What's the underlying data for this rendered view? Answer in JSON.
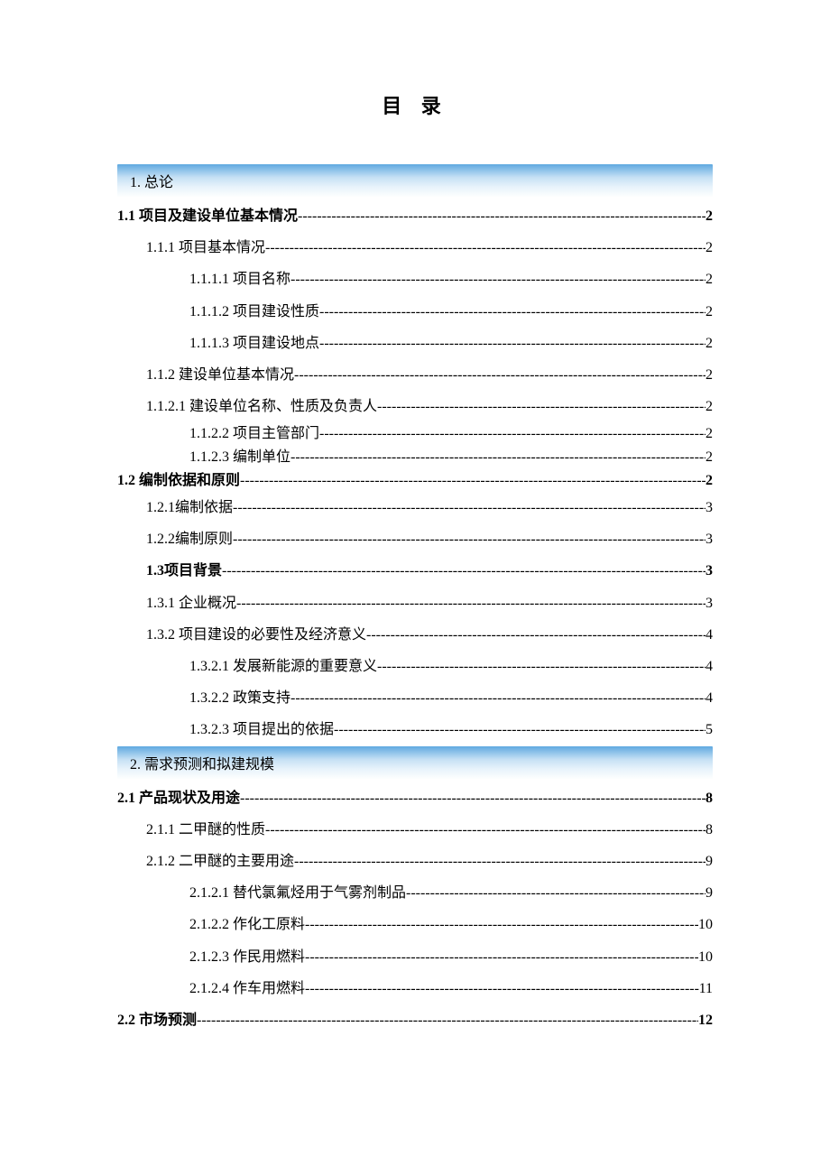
{
  "title": "目 录",
  "sections": [
    {
      "header": "1.  总论",
      "items": [
        {
          "label": "1.1 项目及建设单位基本情况",
          "page": "2",
          "indent": 0,
          "bold": true
        },
        {
          "label": "1.1.1 项目基本情况",
          "page": "2",
          "indent": 1,
          "bold": false
        },
        {
          "label": "1.1.1.1 项目名称",
          "page": "2",
          "indent": 2,
          "bold": false
        },
        {
          "label": "1.1.1.2 项目建设性质",
          "page": "2",
          "indent": 2,
          "bold": false
        },
        {
          "label": "1.1.1.3 项目建设地点",
          "page": "2",
          "indent": 2,
          "bold": false
        },
        {
          "label": "1.1.2 建设单位基本情况",
          "page": "2",
          "indent": 1,
          "bold": false
        },
        {
          "label": "1.1.2.1 建设单位名称、性质及负责人",
          "page": "2",
          "indent": 1,
          "bold": false
        },
        {
          "label": "1.1.2.2 项目主管部门",
          "page": "2",
          "indent": 2,
          "bold": false,
          "tight": true
        },
        {
          "label": "1.1.2.3 编制单位",
          "page": "2",
          "indent": 2,
          "bold": false,
          "tight": true
        },
        {
          "label": "1.2 编制依据和原则",
          "page": "2",
          "indent": 0,
          "bold": true,
          "tight": true
        },
        {
          "label": "1.2.1编制依据",
          "page": "3",
          "indent": 1,
          "bold": false
        },
        {
          "label": "1.2.2编制原则",
          "page": "3",
          "indent": 1,
          "bold": false
        },
        {
          "label": "1.3项目背景",
          "page": "3",
          "indent": 1,
          "bold": true
        },
        {
          "label": "1.3.1 企业概况",
          "page": "3",
          "indent": 1,
          "bold": false
        },
        {
          "label": "1.3.2 项目建设的必要性及经济意义",
          "page": "4",
          "indent": 1,
          "bold": false
        },
        {
          "label": "1.3.2.1 发展新能源的重要意义",
          "page": "4",
          "indent": 2,
          "bold": false
        },
        {
          "label": "1.3.2.2 政策支持",
          "page": "4",
          "indent": 2,
          "bold": false
        },
        {
          "label": "1.3.2.3 项目提出的依据",
          "page": "5",
          "indent": 2,
          "bold": false
        }
      ]
    },
    {
      "header": "2.  需求预测和拟建规模",
      "items": [
        {
          "label": "2.1 产品现状及用途",
          "page": "8",
          "indent": 0,
          "bold": true
        },
        {
          "label": "2.1.1 二甲醚的性质",
          "page": "8",
          "indent": 1,
          "bold": false
        },
        {
          "label": "2.1.2 二甲醚的主要用途",
          "page": "9",
          "indent": 1,
          "bold": false
        },
        {
          "label": "2.1.2.1 替代氯氟烃用于气雾剂制品",
          "page": "9",
          "indent": 2,
          "bold": false
        },
        {
          "label": "2.1.2.2 作化工原料",
          "page": "10",
          "indent": 2,
          "bold": false
        },
        {
          "label": "2.1.2.3 作民用燃料",
          "page": "10",
          "indent": 2,
          "bold": false
        },
        {
          "label": "2.1.2.4 作车用燃料",
          "page": "11",
          "indent": 2,
          "bold": false
        },
        {
          "label": "2.2 市场预测",
          "page": "12",
          "indent": 0,
          "bold": true
        }
      ]
    }
  ]
}
